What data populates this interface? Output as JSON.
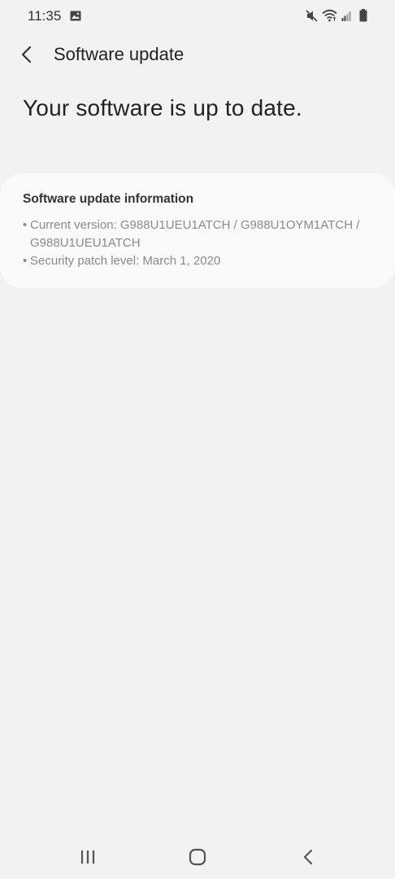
{
  "status_bar": {
    "time": "11:35"
  },
  "header": {
    "title": "Software update"
  },
  "main": {
    "headline": "Your software is up to date."
  },
  "info_card": {
    "title": "Software update information",
    "current_version_line1": "Current version: G988U1UEU1ATCH / G988U1OYM1ATCH /",
    "current_version_line2": "G988U1UEU1ATCH",
    "security_patch": "Security patch level: March 1, 2020"
  },
  "icons": {
    "status": [
      "gallery-icon",
      "mute-icon",
      "wifi-icon",
      "signal-icon",
      "battery-icon"
    ],
    "header": [
      "back-arrow-icon"
    ],
    "nav": [
      "recent-apps-icon",
      "home-icon",
      "nav-back-icon"
    ]
  },
  "colors": {
    "background": "#f2f2f2",
    "card": "#fafafa",
    "text_primary": "#222222",
    "text_secondary": "#8a8a8a"
  }
}
